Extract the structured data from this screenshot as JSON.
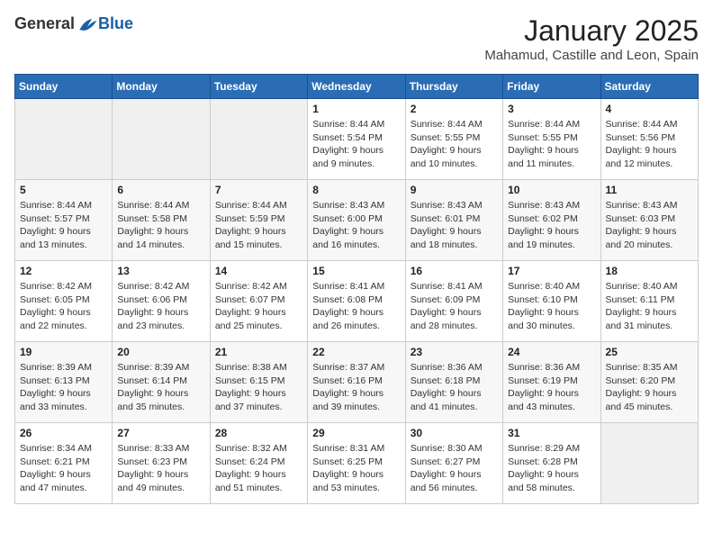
{
  "header": {
    "logo_general": "General",
    "logo_blue": "Blue",
    "month": "January 2025",
    "location": "Mahamud, Castille and Leon, Spain"
  },
  "weekdays": [
    "Sunday",
    "Monday",
    "Tuesday",
    "Wednesday",
    "Thursday",
    "Friday",
    "Saturday"
  ],
  "weeks": [
    [
      {
        "day": "",
        "info": ""
      },
      {
        "day": "",
        "info": ""
      },
      {
        "day": "",
        "info": ""
      },
      {
        "day": "1",
        "info": "Sunrise: 8:44 AM\nSunset: 5:54 PM\nDaylight: 9 hours and 9 minutes."
      },
      {
        "day": "2",
        "info": "Sunrise: 8:44 AM\nSunset: 5:55 PM\nDaylight: 9 hours and 10 minutes."
      },
      {
        "day": "3",
        "info": "Sunrise: 8:44 AM\nSunset: 5:55 PM\nDaylight: 9 hours and 11 minutes."
      },
      {
        "day": "4",
        "info": "Sunrise: 8:44 AM\nSunset: 5:56 PM\nDaylight: 9 hours and 12 minutes."
      }
    ],
    [
      {
        "day": "5",
        "info": "Sunrise: 8:44 AM\nSunset: 5:57 PM\nDaylight: 9 hours and 13 minutes."
      },
      {
        "day": "6",
        "info": "Sunrise: 8:44 AM\nSunset: 5:58 PM\nDaylight: 9 hours and 14 minutes."
      },
      {
        "day": "7",
        "info": "Sunrise: 8:44 AM\nSunset: 5:59 PM\nDaylight: 9 hours and 15 minutes."
      },
      {
        "day": "8",
        "info": "Sunrise: 8:43 AM\nSunset: 6:00 PM\nDaylight: 9 hours and 16 minutes."
      },
      {
        "day": "9",
        "info": "Sunrise: 8:43 AM\nSunset: 6:01 PM\nDaylight: 9 hours and 18 minutes."
      },
      {
        "day": "10",
        "info": "Sunrise: 8:43 AM\nSunset: 6:02 PM\nDaylight: 9 hours and 19 minutes."
      },
      {
        "day": "11",
        "info": "Sunrise: 8:43 AM\nSunset: 6:03 PM\nDaylight: 9 hours and 20 minutes."
      }
    ],
    [
      {
        "day": "12",
        "info": "Sunrise: 8:42 AM\nSunset: 6:05 PM\nDaylight: 9 hours and 22 minutes."
      },
      {
        "day": "13",
        "info": "Sunrise: 8:42 AM\nSunset: 6:06 PM\nDaylight: 9 hours and 23 minutes."
      },
      {
        "day": "14",
        "info": "Sunrise: 8:42 AM\nSunset: 6:07 PM\nDaylight: 9 hours and 25 minutes."
      },
      {
        "day": "15",
        "info": "Sunrise: 8:41 AM\nSunset: 6:08 PM\nDaylight: 9 hours and 26 minutes."
      },
      {
        "day": "16",
        "info": "Sunrise: 8:41 AM\nSunset: 6:09 PM\nDaylight: 9 hours and 28 minutes."
      },
      {
        "day": "17",
        "info": "Sunrise: 8:40 AM\nSunset: 6:10 PM\nDaylight: 9 hours and 30 minutes."
      },
      {
        "day": "18",
        "info": "Sunrise: 8:40 AM\nSunset: 6:11 PM\nDaylight: 9 hours and 31 minutes."
      }
    ],
    [
      {
        "day": "19",
        "info": "Sunrise: 8:39 AM\nSunset: 6:13 PM\nDaylight: 9 hours and 33 minutes."
      },
      {
        "day": "20",
        "info": "Sunrise: 8:39 AM\nSunset: 6:14 PM\nDaylight: 9 hours and 35 minutes."
      },
      {
        "day": "21",
        "info": "Sunrise: 8:38 AM\nSunset: 6:15 PM\nDaylight: 9 hours and 37 minutes."
      },
      {
        "day": "22",
        "info": "Sunrise: 8:37 AM\nSunset: 6:16 PM\nDaylight: 9 hours and 39 minutes."
      },
      {
        "day": "23",
        "info": "Sunrise: 8:36 AM\nSunset: 6:18 PM\nDaylight: 9 hours and 41 minutes."
      },
      {
        "day": "24",
        "info": "Sunrise: 8:36 AM\nSunset: 6:19 PM\nDaylight: 9 hours and 43 minutes."
      },
      {
        "day": "25",
        "info": "Sunrise: 8:35 AM\nSunset: 6:20 PM\nDaylight: 9 hours and 45 minutes."
      }
    ],
    [
      {
        "day": "26",
        "info": "Sunrise: 8:34 AM\nSunset: 6:21 PM\nDaylight: 9 hours and 47 minutes."
      },
      {
        "day": "27",
        "info": "Sunrise: 8:33 AM\nSunset: 6:23 PM\nDaylight: 9 hours and 49 minutes."
      },
      {
        "day": "28",
        "info": "Sunrise: 8:32 AM\nSunset: 6:24 PM\nDaylight: 9 hours and 51 minutes."
      },
      {
        "day": "29",
        "info": "Sunrise: 8:31 AM\nSunset: 6:25 PM\nDaylight: 9 hours and 53 minutes."
      },
      {
        "day": "30",
        "info": "Sunrise: 8:30 AM\nSunset: 6:27 PM\nDaylight: 9 hours and 56 minutes."
      },
      {
        "day": "31",
        "info": "Sunrise: 8:29 AM\nSunset: 6:28 PM\nDaylight: 9 hours and 58 minutes."
      },
      {
        "day": "",
        "info": ""
      }
    ]
  ]
}
